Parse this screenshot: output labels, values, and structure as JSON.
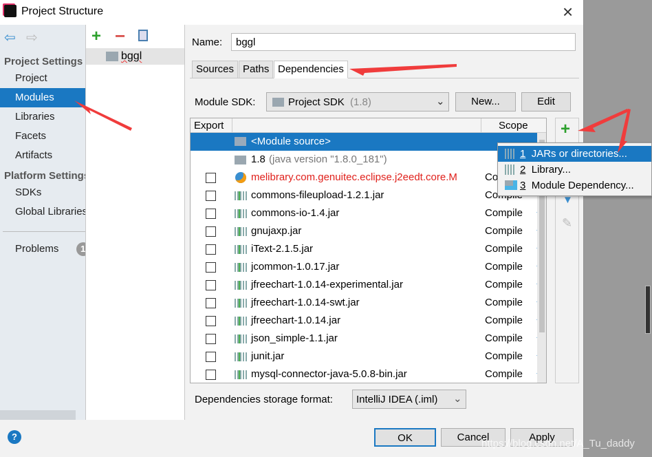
{
  "window": {
    "title": "Project Structure",
    "close": "×"
  },
  "sidebar": {
    "project_settings": "Project Settings",
    "items": [
      {
        "label": "Project"
      },
      {
        "label": "Modules"
      },
      {
        "label": "Libraries"
      },
      {
        "label": "Facets"
      },
      {
        "label": "Artifacts"
      }
    ],
    "platform_settings": "Platform Settings",
    "platform_items": [
      {
        "label": "SDKs"
      },
      {
        "label": "Global Libraries"
      }
    ],
    "problems": "Problems",
    "problems_count": "1",
    "selected": "Modules"
  },
  "modules": {
    "items": [
      {
        "label": "bggl"
      }
    ]
  },
  "detail": {
    "name_label": "Name:",
    "name_value": "bggl",
    "tabs": [
      {
        "label": "Sources"
      },
      {
        "label": "Paths"
      },
      {
        "label": "Dependencies"
      }
    ],
    "active_tab": "Dependencies",
    "sdk_label": "Module SDK:",
    "sdk_value": "Project SDK",
    "sdk_version": "(1.8)",
    "new_button": "New...",
    "edit_button": "Edit",
    "columns": {
      "export": "Export",
      "scope": "Scope"
    },
    "rows": [
      {
        "name": "<Module source>",
        "scope": ""
      },
      {
        "name": "1.8",
        "extra": "(java version \"1.8.0_181\")",
        "scope": ""
      },
      {
        "name": "melibrary.com.genuitec.eclipse.j2eedt.core.M",
        "scope": "Co"
      },
      {
        "name": "commons-fileupload-1.2.1.jar",
        "scope": "Compile"
      },
      {
        "name": "commons-io-1.4.jar",
        "scope": "Compile"
      },
      {
        "name": "gnujaxp.jar",
        "scope": "Compile"
      },
      {
        "name": "iText-2.1.5.jar",
        "scope": "Compile"
      },
      {
        "name": "jcommon-1.0.17.jar",
        "scope": "Compile"
      },
      {
        "name": "jfreechart-1.0.14-experimental.jar",
        "scope": "Compile"
      },
      {
        "name": "jfreechart-1.0.14-swt.jar",
        "scope": "Compile"
      },
      {
        "name": "jfreechart-1.0.14.jar",
        "scope": "Compile"
      },
      {
        "name": "json_simple-1.1.jar",
        "scope": "Compile"
      },
      {
        "name": "junit.jar",
        "scope": "Compile"
      },
      {
        "name": "mysql-connector-java-5.0.8-bin.jar",
        "scope": "Compile"
      }
    ],
    "storage_label": "Dependencies storage format:",
    "storage_value": "IntelliJ IDEA (.iml)"
  },
  "popup": {
    "items": [
      {
        "num": "1",
        "label": "JARs or directories..."
      },
      {
        "num": "2",
        "label": "Library..."
      },
      {
        "num": "3",
        "label": "Module Dependency..."
      }
    ]
  },
  "footer": {
    "ok": "OK",
    "cancel": "Cancel",
    "apply": "Apply",
    "help": "?"
  },
  "watermark": "https://blog.csdn.net/A_Tu_daddy",
  "colors": {
    "selection": "#1a78c2",
    "error": "#e0201b",
    "add": "#2ca02c",
    "remove": "#d9534f",
    "annotation_arrow": "#f03c3c"
  }
}
